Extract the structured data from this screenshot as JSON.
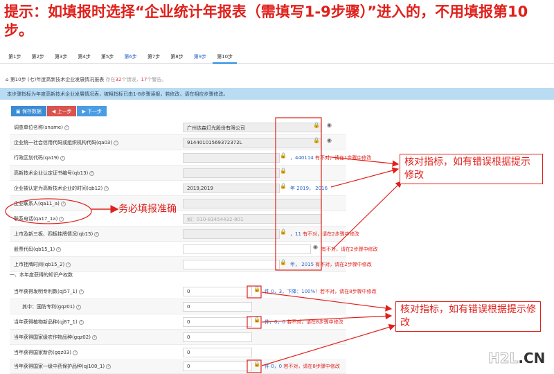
{
  "banner": {
    "text": "提示：如填报时选择“企业统计年报表（需填写1-9步骤）”进入的，不用填报第10步。"
  },
  "steps": [
    {
      "label": "第1步",
      "style": ""
    },
    {
      "label": "第2步",
      "style": ""
    },
    {
      "label": "第3步",
      "style": ""
    },
    {
      "label": "第4步",
      "style": ""
    },
    {
      "label": "第5步",
      "style": ""
    },
    {
      "label": "第6步",
      "style": "blue"
    },
    {
      "label": "第7步",
      "style": ""
    },
    {
      "label": "第8步",
      "style": ""
    },
    {
      "label": "第9步",
      "style": "blue"
    },
    {
      "label": "第10步",
      "style": "active"
    }
  ],
  "crumb": {
    "main": "第10步 (七)年度高新技术企业发展情况报表",
    "gray1": "存在",
    "red1": "32",
    "gray2": "个错误，",
    "red2": "17",
    "gray3": "个警告。"
  },
  "notice": "本步骤指标为年度高新技术企业发展情况表，被粗指标已由1-8步骤读报，若修改，请在相应步骤修改。",
  "toolbar": {
    "save": "保存数据",
    "prev": "上一步",
    "next": "下一步"
  },
  "rows": {
    "sname": {
      "label": "调查单位名称(sname)",
      "value": "广州达森灯光股份有限公司"
    },
    "qa03": {
      "label": "企业统一社会信用代码或组织机构代码(qa03)",
      "value": "91440101569372372L"
    },
    "qa19": {
      "label": "行政区划代码(qa19)",
      "value": "",
      "hint_val": "，440114",
      "hint_err": "有不对，请在1步骤中修改"
    },
    "qb13": {
      "label": "高新技术企业认定证书编号(qb13)",
      "value": ""
    },
    "qb12": {
      "label": "企业被认定为高新技术企业的时间(qb12)",
      "value": "2019,2019",
      "hint_val": "年 2019， 2016"
    },
    "qa11": {
      "label": "企业联系人(qa11_a)",
      "value": ""
    },
    "qa17": {
      "label": "联系电话(qa17_1a)",
      "value": "如：010-83454432-801"
    },
    "qb15": {
      "label": "上市及新三板、四板挂牌情况(qb15)",
      "value": "",
      "hint_val": "，11",
      "hint_err": "有不对，请在2步骤中修改"
    },
    "qb15_1": {
      "label": "股票代码(qb15_1)",
      "value": "",
      "hint_err": "有不对，请在2步骤中修改"
    },
    "qb15_2": {
      "label": "上市挂牌时间(qb15_2)",
      "value": "",
      "hint_val": "年， 2015",
      "hint_err": "有不对，请在2步骤中修改"
    },
    "qj57": {
      "label": "当年获得发明专利数(qj57_1)",
      "value": "0",
      "hint_val": "件 0，3，下降：100%",
      "hint_err": "！若不对，请在8步骤中修改"
    },
    "gqz01": {
      "label": "其中：国防专利(gqz01)",
      "value": "0"
    },
    "qj87": {
      "label": "当年获得植物新品种(qj87_1)",
      "value": "0",
      "hint_val": "件，0，0",
      "hint_err": "若不对，请在8步骤中修改"
    },
    "gqz02": {
      "label": "当年获得国家级农作物品种(gqz02)",
      "value": "0"
    },
    "gqz03": {
      "label": "当年获得国家新药(gqz03)",
      "value": "0"
    },
    "qj100": {
      "label": "当年获得国家一级中药保护品种(qj100_1)",
      "value": "0",
      "hint_val": "件 0，0",
      "hint_err": "若不对，请在8步骤中修改"
    }
  },
  "section": "一、本年度获得的知识产权数",
  "annotations": {
    "check_note_top": "核对指标，如有错误根据提示修改",
    "check_note_bottom": "核对指标，如有错误根据提示修改",
    "must_fill": "务必填报准确"
  },
  "watermark": {
    "left": "H2L",
    "right": ".CN"
  },
  "colors": {
    "accent_red": "#e0201b",
    "notice_bg": "#b9dcf2",
    "link_blue": "#2a63c9"
  }
}
